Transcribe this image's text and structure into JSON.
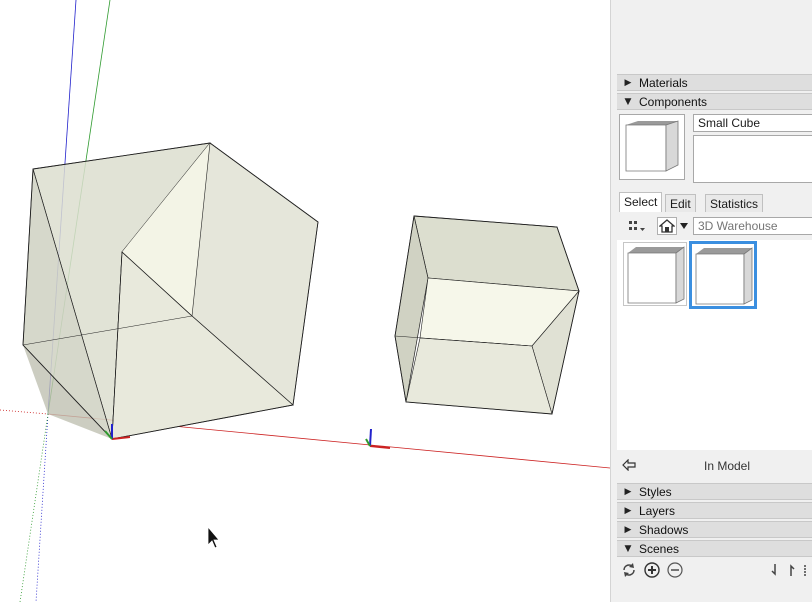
{
  "panels": {
    "materials": {
      "label": "Materials",
      "state": "collapsed"
    },
    "components": {
      "label": "Components",
      "state": "expanded"
    },
    "styles": {
      "label": "Styles",
      "state": "collapsed"
    },
    "layers": {
      "label": "Layers",
      "state": "collapsed"
    },
    "shadows": {
      "label": "Shadows",
      "state": "collapsed"
    },
    "scenes": {
      "label": "Scenes",
      "state": "expanded"
    }
  },
  "components": {
    "name": "Small Cube",
    "description": "",
    "tabs": [
      "Select",
      "Edit",
      "Statistics"
    ],
    "active_tab": "Select",
    "search_placeholder": "3D Warehouse",
    "navigation_location": "In Model",
    "results": [
      {
        "icon": "cube-thumbnail",
        "selected": false
      },
      {
        "icon": "cube-thumbnail",
        "selected": true
      }
    ]
  },
  "icons": {
    "collapsed": "▶",
    "expanded": "▼",
    "view_options": "view-options-icon",
    "home": "home-icon",
    "dropdown": "chevron-down-icon",
    "back": "back-arrow-icon",
    "scenes_update": "refresh-icon",
    "scenes_add": "add-icon",
    "scenes_remove": "remove-icon",
    "scenes_move_down": "move-down-icon",
    "scenes_move_up": "move-up-icon"
  },
  "colors": {
    "selection": "#3b8fe0",
    "cube_face": "#dfe0d4",
    "cube_inner_light": "#f6f7ea",
    "red_axis": "#cc2222",
    "green_axis": "#2e9a2e",
    "blue_axis": "#2222cc"
  }
}
